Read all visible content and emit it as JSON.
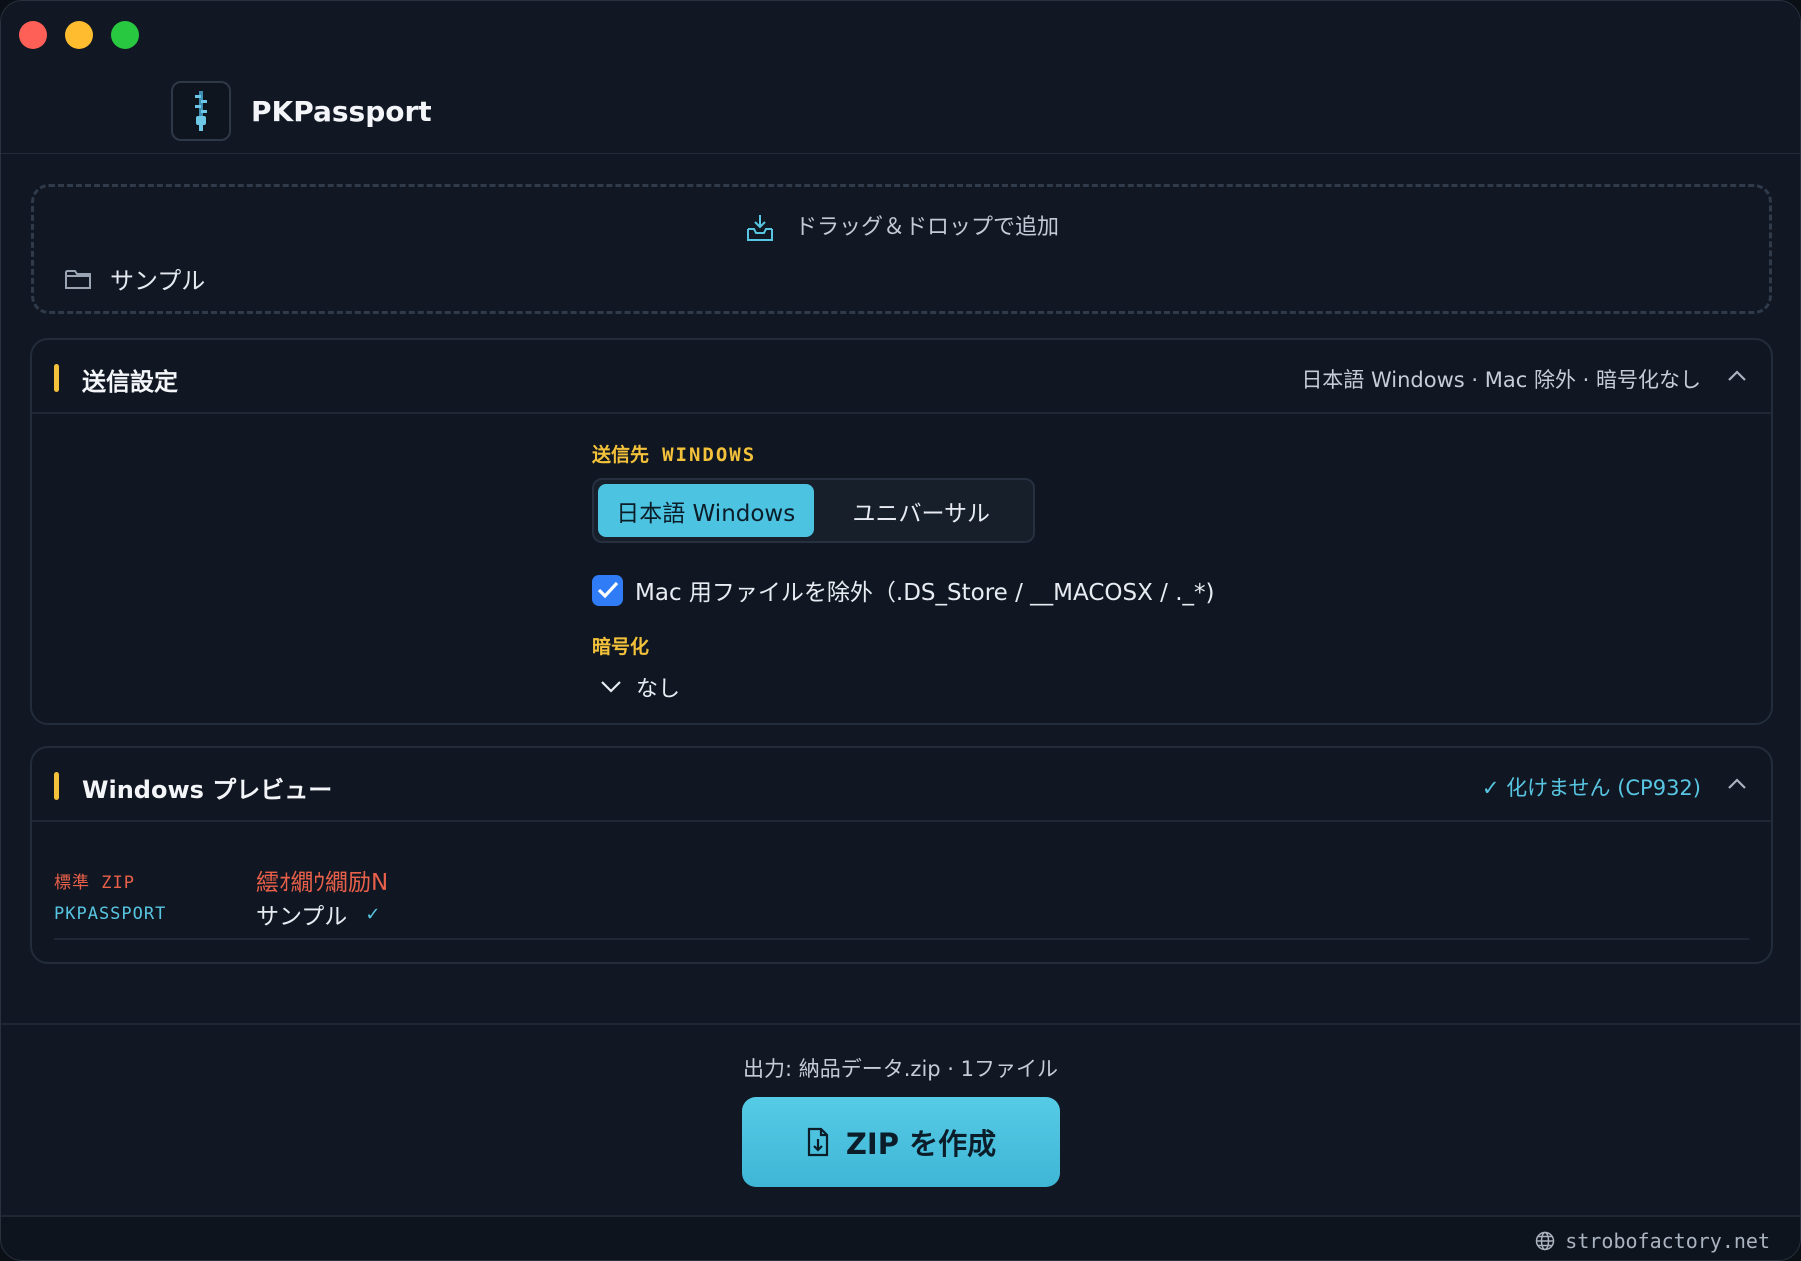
{
  "app": {
    "title": "PKPassport"
  },
  "dropzone": {
    "hint": "ドラッグ＆ドロップで追加",
    "item": "サンプル"
  },
  "send_settings": {
    "title": "送信設定",
    "summary": "日本語 Windows · Mac 除外 · 暗号化なし",
    "dest_label": "送信先",
    "dest_value": "WINDOWS",
    "options": [
      "日本語 Windows",
      "ユニバーサル"
    ],
    "selected": "日本語 Windows",
    "exclude_mac_label": "Mac 用ファイルを除外（.DS_Store / __MACOSX / ._*)",
    "exclude_mac_checked": true,
    "encryption_label": "暗号化",
    "encryption_value": "なし"
  },
  "preview": {
    "title": "Windows プレビュー",
    "status": "✓ 化けません (CP932)",
    "rows": [
      {
        "key": "標準 ZIP",
        "value": "繧ｵ繝ｳ繝励Ν",
        "status": ""
      },
      {
        "key": "PKPASSPORT",
        "value": "サンプル",
        "status": "✓"
      }
    ]
  },
  "footer": {
    "output_info": "出力: 納品データ.zip · 1ファイル",
    "create_button": "ZIP を作成",
    "site": "strobofactory.net"
  },
  "colors": {
    "accent": "#4cc3e0",
    "highlight": "#f3c13a",
    "error": "#e9604a"
  }
}
